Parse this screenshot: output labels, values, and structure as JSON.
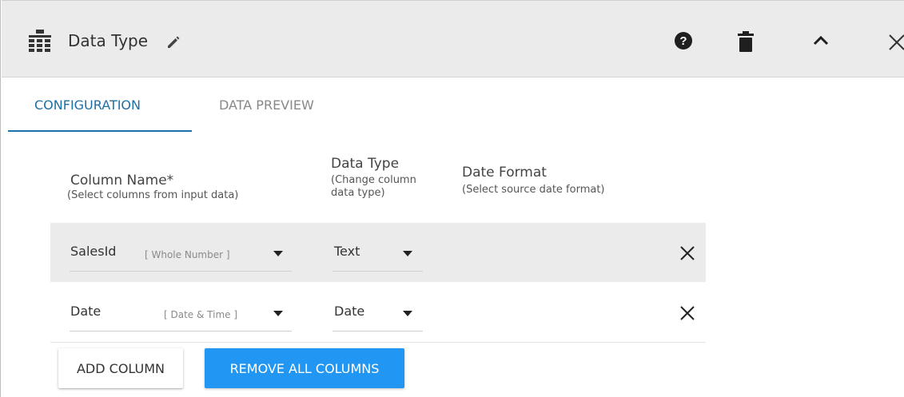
{
  "header": {
    "title": "Data Type",
    "icons": {
      "module": "hierarchy-icon",
      "edit": "pencil-icon",
      "help": "help-circle-icon",
      "delete": "trash-icon",
      "collapse": "chevron-up-icon",
      "close": "close-icon"
    },
    "background": "#ebebeb"
  },
  "tabs": [
    {
      "label": "CONFIGURATION",
      "active": true
    },
    {
      "label": "DATA PREVIEW",
      "active": false
    }
  ],
  "columns_header": {
    "column_name": "Column Name*",
    "column_name_hint": "(Select columns from input data)",
    "data_type": "Data Type",
    "data_type_hint": "(Change column data type)",
    "date_format": "Date Format",
    "date_format_hint": "(Select source date format)"
  },
  "rows": [
    {
      "column": "SalesId",
      "kind": "[ Whole Number ]",
      "type": "Text"
    },
    {
      "column": "Date",
      "kind": "[ Date & Time ]",
      "type": "Date"
    }
  ],
  "buttons": {
    "add_column": "ADD COLUMN",
    "remove_all": "REMOVE ALL COLUMNS"
  },
  "colors": {
    "accent": "#1d6fa6",
    "primary_button": "#2196f3"
  }
}
